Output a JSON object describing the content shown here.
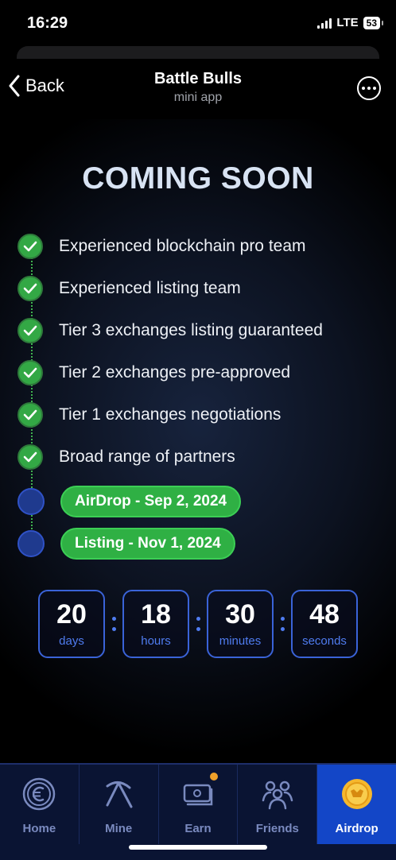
{
  "status": {
    "time": "16:29",
    "network": "LTE",
    "battery": "53"
  },
  "header": {
    "back_label": "Back",
    "title": "Battle Bulls",
    "subtitle": "mini app"
  },
  "heading": "COMING SOON",
  "checklist": [
    {
      "label": "Experienced blockchain pro team",
      "done": true
    },
    {
      "label": "Experienced listing team",
      "done": true
    },
    {
      "label": "Tier 3 exchanges listing guaranteed",
      "done": true
    },
    {
      "label": "Tier 2 exchanges pre-approved",
      "done": true
    },
    {
      "label": "Tier 1 exchanges negotiations",
      "done": true
    },
    {
      "label": "Broad range of partners",
      "done": true
    }
  ],
  "milestones": [
    {
      "label": "AirDrop - Sep 2, 2024"
    },
    {
      "label": "Listing - Nov 1, 2024"
    }
  ],
  "countdown": [
    {
      "value": "20",
      "unit": "days"
    },
    {
      "value": "18",
      "unit": "hours"
    },
    {
      "value": "30",
      "unit": "minutes"
    },
    {
      "value": "48",
      "unit": "seconds"
    }
  ],
  "nav": [
    {
      "label": "Home",
      "icon": "euro-coin-icon"
    },
    {
      "label": "Mine",
      "icon": "pickaxe-icon"
    },
    {
      "label": "Earn",
      "icon": "cash-icon"
    },
    {
      "label": "Friends",
      "icon": "friends-icon"
    },
    {
      "label": "Airdrop",
      "icon": "airdrop-coin-icon",
      "active": true
    }
  ],
  "colors": {
    "accent_green": "#33a845",
    "accent_blue": "#1346c7",
    "countdown_border": "#3a63d8",
    "badge_orange": "#f0a12a"
  }
}
